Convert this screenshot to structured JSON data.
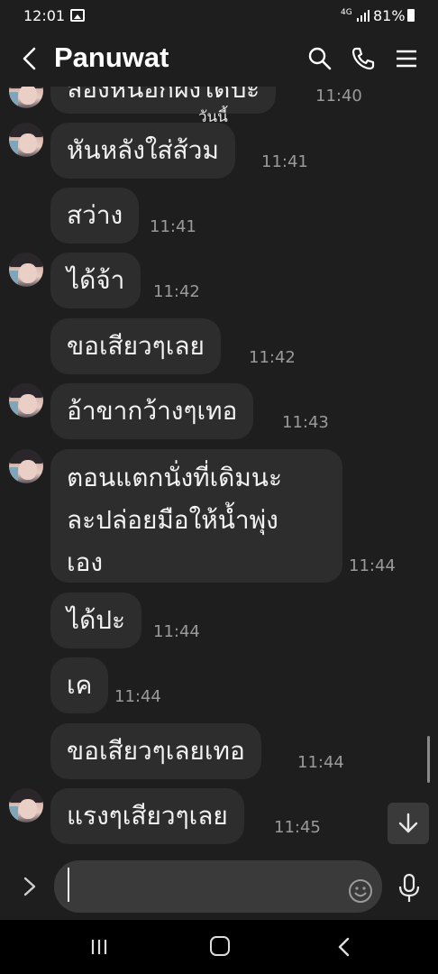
{
  "status": {
    "time": "12:01",
    "network": "4G",
    "battery": "81%"
  },
  "header": {
    "title": "Panuwat"
  },
  "chat": {
    "date_label": "วันนี้",
    "partial_message": {
      "text": "ลองหันอีกฝั่งได้ปะ",
      "time": "11:40"
    },
    "messages": [
      {
        "text": "หันหลังใส่ส้วม",
        "time": "11:41"
      },
      {
        "text": "สว่าง",
        "time": "11:41"
      },
      {
        "text": "ได้จ้า",
        "time": "11:42"
      },
      {
        "text": "ขอเสียวๆเลย",
        "time": "11:42"
      },
      {
        "text": "อ้าขากว้างๆเทอ",
        "time": "11:43"
      },
      {
        "lines": [
          "ตอนแตกนั่งที่เดิมนะ",
          "ละปล่อยมือให้น้ำพุ่ง",
          "เอง"
        ],
        "time": "11:44"
      },
      {
        "text": "ได้ปะ",
        "time": "11:44"
      },
      {
        "text": "เค",
        "time": "11:44"
      },
      {
        "text": "ขอเสียวๆเลยเทอ",
        "time": "11:44"
      },
      {
        "text": "แรงๆเสียวๆเลย",
        "time": "11:45"
      }
    ]
  },
  "input": {
    "value": ""
  },
  "icons": {
    "back": "chevron-left-icon",
    "search": "search-icon",
    "call": "phone-icon",
    "menu": "menu-icon",
    "expand": "chevron-right-icon",
    "emoji": "emoji-icon",
    "mic": "microphone-icon",
    "scroll_down": "arrow-down-icon"
  }
}
